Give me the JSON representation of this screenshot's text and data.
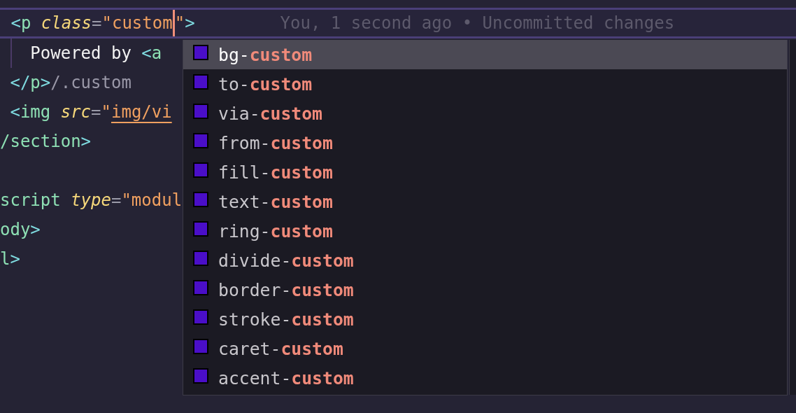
{
  "editor": {
    "lines": [
      {
        "current": true,
        "tokens": [
          {
            "kind": "punct",
            "text": " <"
          },
          {
            "kind": "tag",
            "text": "p"
          },
          {
            "kind": "attr",
            "text": " class"
          },
          {
            "kind": "op",
            "text": "="
          },
          {
            "kind": "string",
            "text": "\"custom",
            "cursor": true
          },
          {
            "kind": "string",
            "text": "\""
          },
          {
            "kind": "punct",
            "text": ">"
          }
        ],
        "blame": "You, 1 second ago • Uncommitted changes"
      },
      {
        "current": false,
        "guide": true,
        "tokens": [
          {
            "kind": "text",
            "text": "   Powered by "
          },
          {
            "kind": "punct",
            "text": "<"
          },
          {
            "kind": "tag",
            "text": "a"
          }
        ]
      },
      {
        "current": false,
        "tokens": [
          {
            "kind": "punct",
            "text": " </"
          },
          {
            "kind": "tag",
            "text": "p"
          },
          {
            "kind": "punct",
            "text": ">"
          },
          {
            "kind": "comment",
            "text": "/.custom"
          }
        ]
      },
      {
        "current": false,
        "tokens": [
          {
            "kind": "punct",
            "text": " <"
          },
          {
            "kind": "tag",
            "text": "img"
          },
          {
            "kind": "attr",
            "text": " src"
          },
          {
            "kind": "op",
            "text": "="
          },
          {
            "kind": "string",
            "text": "\""
          },
          {
            "kind": "link",
            "text": "img/vi"
          }
        ]
      },
      {
        "current": false,
        "tokens": [
          {
            "kind": "tag",
            "text": "/section"
          },
          {
            "kind": "punct",
            "text": ">"
          }
        ]
      },
      {
        "current": false
      },
      {
        "current": false,
        "tokens": [
          {
            "kind": "tag",
            "text": "script"
          },
          {
            "kind": "attr",
            "text": " type"
          },
          {
            "kind": "op",
            "text": "="
          },
          {
            "kind": "string",
            "text": "\"modul"
          }
        ]
      },
      {
        "current": false,
        "tokens": [
          {
            "kind": "tag",
            "text": "ody"
          },
          {
            "kind": "punct",
            "text": ">"
          }
        ]
      },
      {
        "current": false,
        "tokens": [
          {
            "kind": "tag",
            "text": "l"
          },
          {
            "kind": "punct",
            "text": ">"
          }
        ]
      }
    ]
  },
  "suggestions": [
    {
      "prefix": "bg-",
      "match": "custom",
      "color": "#4a0ec8",
      "selected": true
    },
    {
      "prefix": "to-",
      "match": "custom",
      "color": "#4a0ec8",
      "selected": false
    },
    {
      "prefix": "via-",
      "match": "custom",
      "color": "#4a0ec8",
      "selected": false
    },
    {
      "prefix": "from-",
      "match": "custom",
      "color": "#4a0ec8",
      "selected": false
    },
    {
      "prefix": "fill-",
      "match": "custom",
      "color": "#4a0ec8",
      "selected": false
    },
    {
      "prefix": "text-",
      "match": "custom",
      "color": "#4a0ec8",
      "selected": false
    },
    {
      "prefix": "ring-",
      "match": "custom",
      "color": "#4a0ec8",
      "selected": false
    },
    {
      "prefix": "divide-",
      "match": "custom",
      "color": "#4a0ec8",
      "selected": false
    },
    {
      "prefix": "border-",
      "match": "custom",
      "color": "#4a0ec8",
      "selected": false
    },
    {
      "prefix": "stroke-",
      "match": "custom",
      "color": "#4a0ec8",
      "selected": false
    },
    {
      "prefix": "caret-",
      "match": "custom",
      "color": "#4a0ec8",
      "selected": false
    },
    {
      "prefix": "accent-",
      "match": "custom",
      "color": "#4a0ec8",
      "selected": false
    }
  ]
}
